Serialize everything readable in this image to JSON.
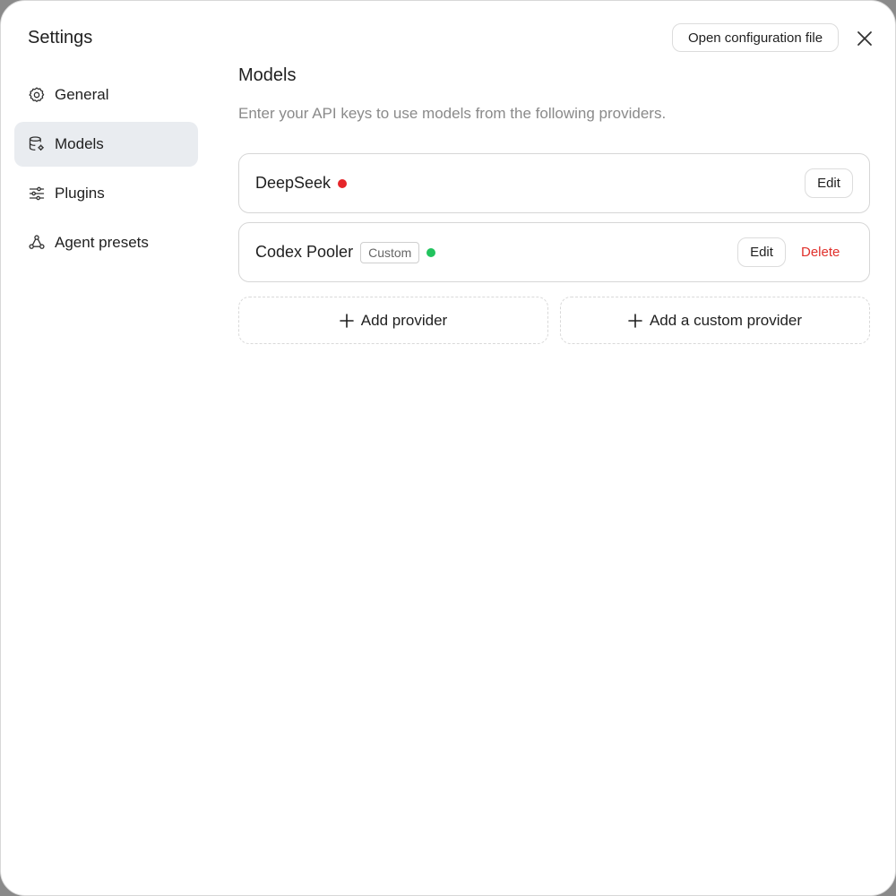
{
  "window": {
    "title": "Settings",
    "open_config_label": "Open configuration file",
    "close_icon": "close-icon"
  },
  "sidebar": {
    "items": [
      {
        "label": "General",
        "icon": "gear-icon",
        "active": false
      },
      {
        "label": "Models",
        "icon": "database-icon",
        "active": true
      },
      {
        "label": "Plugins",
        "icon": "sliders-icon",
        "active": false
      },
      {
        "label": "Agent presets",
        "icon": "agent-network-icon",
        "active": false
      }
    ]
  },
  "main": {
    "title": "Models",
    "description": "Enter your API keys to use models from the following providers.",
    "providers": [
      {
        "name": "DeepSeek",
        "status_color": "#e5252a",
        "edit_label": "Edit"
      },
      {
        "name": "Codex Pooler",
        "badge": "Custom",
        "status_color": "#22c35e",
        "edit_label": "Edit",
        "delete_label": "Delete"
      }
    ],
    "add_provider_label": "Add provider",
    "add_custom_provider_label": "Add a custom provider"
  },
  "colors": {
    "active_item_bg": "#e9ecf0",
    "delete_text": "#e0302b",
    "status_error": "#e5252a",
    "status_ok": "#22c35e"
  }
}
